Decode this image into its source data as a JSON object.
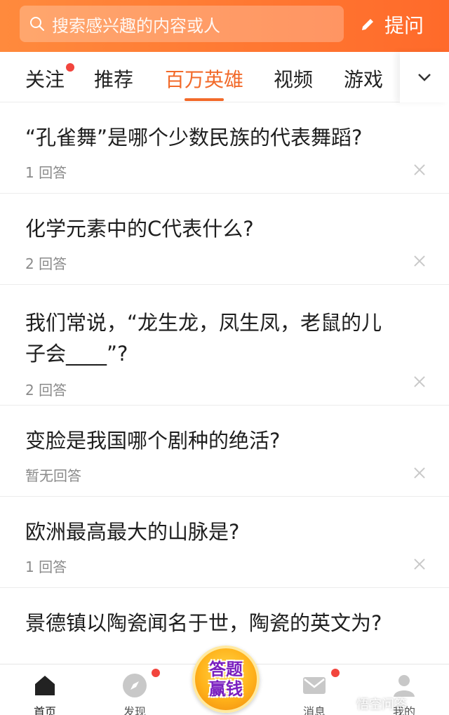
{
  "header": {
    "search_placeholder": "搜索感兴趣的内容或人",
    "ask_label": "提问"
  },
  "tabs": [
    {
      "label": "关注",
      "has_dot": true
    },
    {
      "label": "推荐",
      "has_dot": false
    },
    {
      "label": "百万英雄",
      "active": true
    },
    {
      "label": "视频",
      "has_dot": false
    },
    {
      "label": "游戏",
      "has_dot": false
    }
  ],
  "questions": [
    {
      "title": "“孔雀舞”是哪个少数民族的代表舞蹈?",
      "answers": "1 回答"
    },
    {
      "title": "化学元素中的C代表什么?",
      "answers": "2 回答"
    },
    {
      "title": "我们常说，“龙生龙，凤生凤，老鼠的儿子会____”?",
      "answers": "2 回答"
    },
    {
      "title": "变脸是我国哪个剧种的绝活?",
      "answers": "暂无回答"
    },
    {
      "title": "欧洲最高最大的山脉是?",
      "answers": "1 回答"
    },
    {
      "title": "景德镇以陶瓷闻名于世，陶瓷的英文为?",
      "answers": ""
    }
  ],
  "bottom_nav": [
    {
      "label": "首页",
      "icon": "home-icon",
      "active": true
    },
    {
      "label": "发现",
      "icon": "compass-icon",
      "has_dot": true
    },
    {
      "label": "消息",
      "icon": "message-icon",
      "has_dot": true
    },
    {
      "label": "我的",
      "icon": "profile-icon"
    }
  ],
  "promo": {
    "line1": "答题",
    "line2": "赢钱"
  },
  "watermark": "悟空问答",
  "colors": {
    "accent": "#f26a2a",
    "header": "#ff7a33",
    "dot": "#f2453d"
  }
}
